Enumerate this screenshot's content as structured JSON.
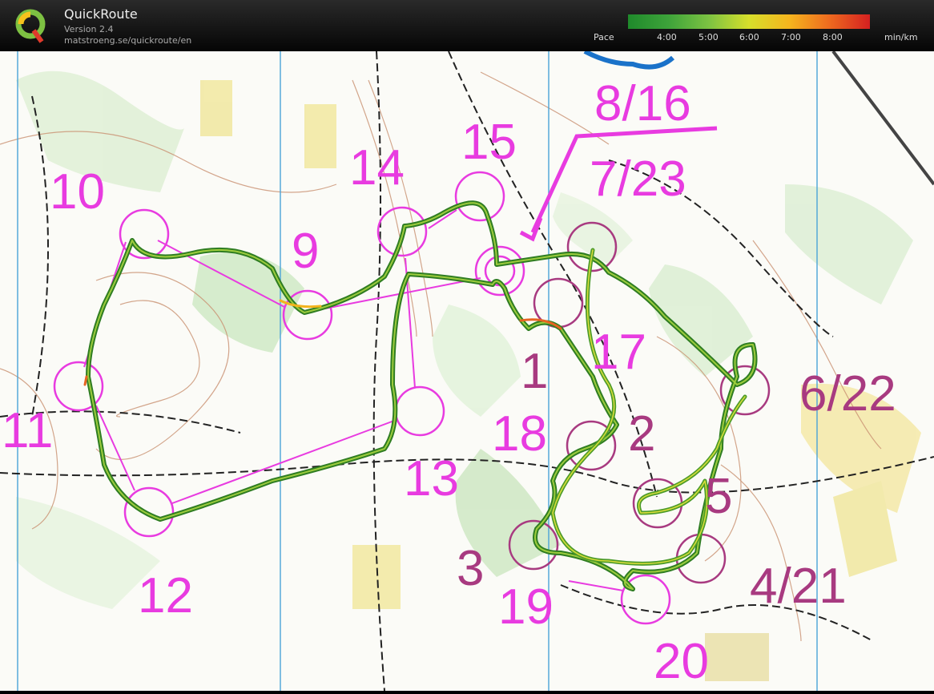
{
  "app": {
    "title": "QuickRoute",
    "version": "Version 2.4",
    "url": "matstroeng.se/quickroute/en"
  },
  "pace_legend": {
    "label": "Pace",
    "ticks": [
      "4:00",
      "5:00",
      "6:00",
      "7:00",
      "8:00"
    ],
    "unit": "min/km",
    "colors": [
      "#1f8a2b",
      "#7cc242",
      "#d7df2b",
      "#f5b51e",
      "#ee6a1f",
      "#d42020"
    ]
  },
  "map": {
    "course_color": "#e83be0",
    "route_color": "#3c8c2a",
    "control_labels": {
      "c1": "1",
      "c2": "2",
      "c3": "3",
      "c4": "4/21",
      "c5": "5",
      "c6": "6/22",
      "c7": "7/23",
      "c8": "8/16",
      "c9": "9",
      "c10": "10",
      "c11": "11",
      "c12": "12",
      "c13": "13",
      "c14": "14",
      "c15": "15",
      "c17": "17",
      "c18": "18",
      "c19": "19",
      "c20": "20"
    }
  }
}
